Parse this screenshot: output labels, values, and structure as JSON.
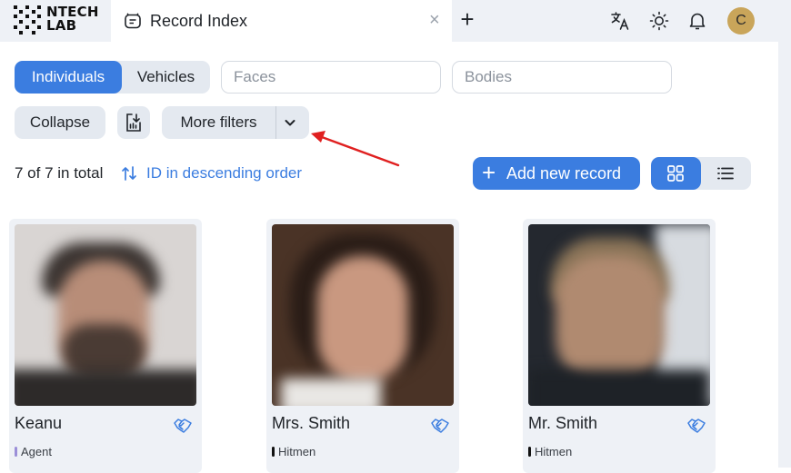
{
  "app": {
    "logo_lines": [
      "NTECH",
      "LAB"
    ],
    "tab_title": "Record Index",
    "tab_close": "×",
    "new_tab": "+",
    "avatar_letter": "C",
    "icons": [
      "translate-icon",
      "theme-sun-icon",
      "notification-bell-icon"
    ]
  },
  "filters": {
    "segments": [
      "Individuals",
      "Vehicles"
    ],
    "active_segment": "Individuals",
    "faces_placeholder": "Faces",
    "bodies_placeholder": "Bodies",
    "collapse_label": "Collapse",
    "more_filters_label": "More filters"
  },
  "listing": {
    "count_text": "7 of 7 in total",
    "sort_text": "ID in descending order",
    "add_label": "Add new record",
    "view_modes": [
      "grid",
      "list"
    ],
    "active_view": "grid"
  },
  "cards": [
    {
      "name": "Keanu",
      "tag": "Agent",
      "tag_color": "#9b8fd8"
    },
    {
      "name": "Mrs. Smith",
      "tag": "Hitmen",
      "tag_color": "#111111"
    },
    {
      "name": "Mr. Smith",
      "tag": "Hitmen",
      "tag_color": "#111111"
    }
  ],
  "colors": {
    "accent": "#3b7de0",
    "annotation_arrow": "#e02020",
    "chrome_bg": "#eef1f6"
  }
}
